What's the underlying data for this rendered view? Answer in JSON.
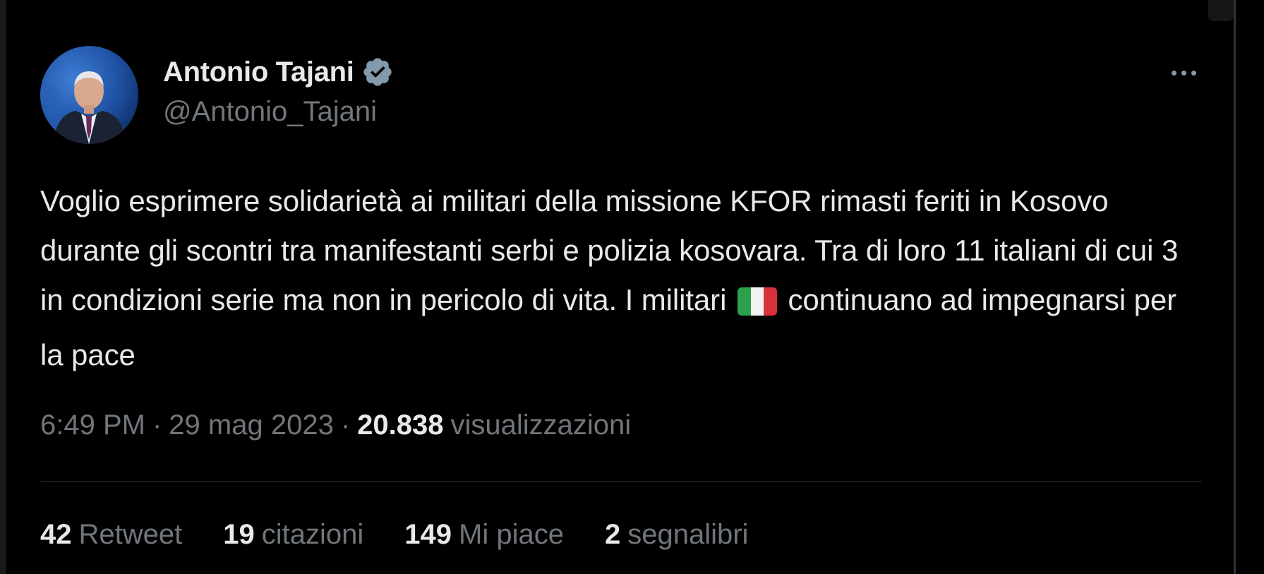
{
  "author": {
    "name": "Antonio Tajani",
    "handle": "@Antonio_Tajani",
    "verified_icon": "verified-badge-icon"
  },
  "tweet": {
    "text_parts": {
      "before_flag": "Voglio esprimere solidarietà ai militari della missione KFOR rimasti feriti in Kosovo durante gli scontri tra manifestanti serbi e polizia kosovara. Tra di loro 11 italiani di cui 3 in condizioni serie ma non in pericolo di vita. I militari",
      "flag_icon": "italian-flag-icon",
      "after_flag": "continuano ad impegnarsi per la pace"
    },
    "time": "6:49 PM",
    "date": "29 mag 2023",
    "separator": "·",
    "views_count": "20.838",
    "views_label": "visualizzazioni"
  },
  "stats": [
    {
      "count": "42",
      "label": "Retweet"
    },
    {
      "count": "19",
      "label": "citazioni"
    },
    {
      "count": "149",
      "label": "Mi piace"
    },
    {
      "count": "2",
      "label": "segnalibri"
    }
  ],
  "colors": {
    "background": "#000000",
    "text_primary": "#e7e9ea",
    "text_secondary": "#71767b",
    "divider": "#2f3336",
    "verified_badge": "#829aab"
  }
}
